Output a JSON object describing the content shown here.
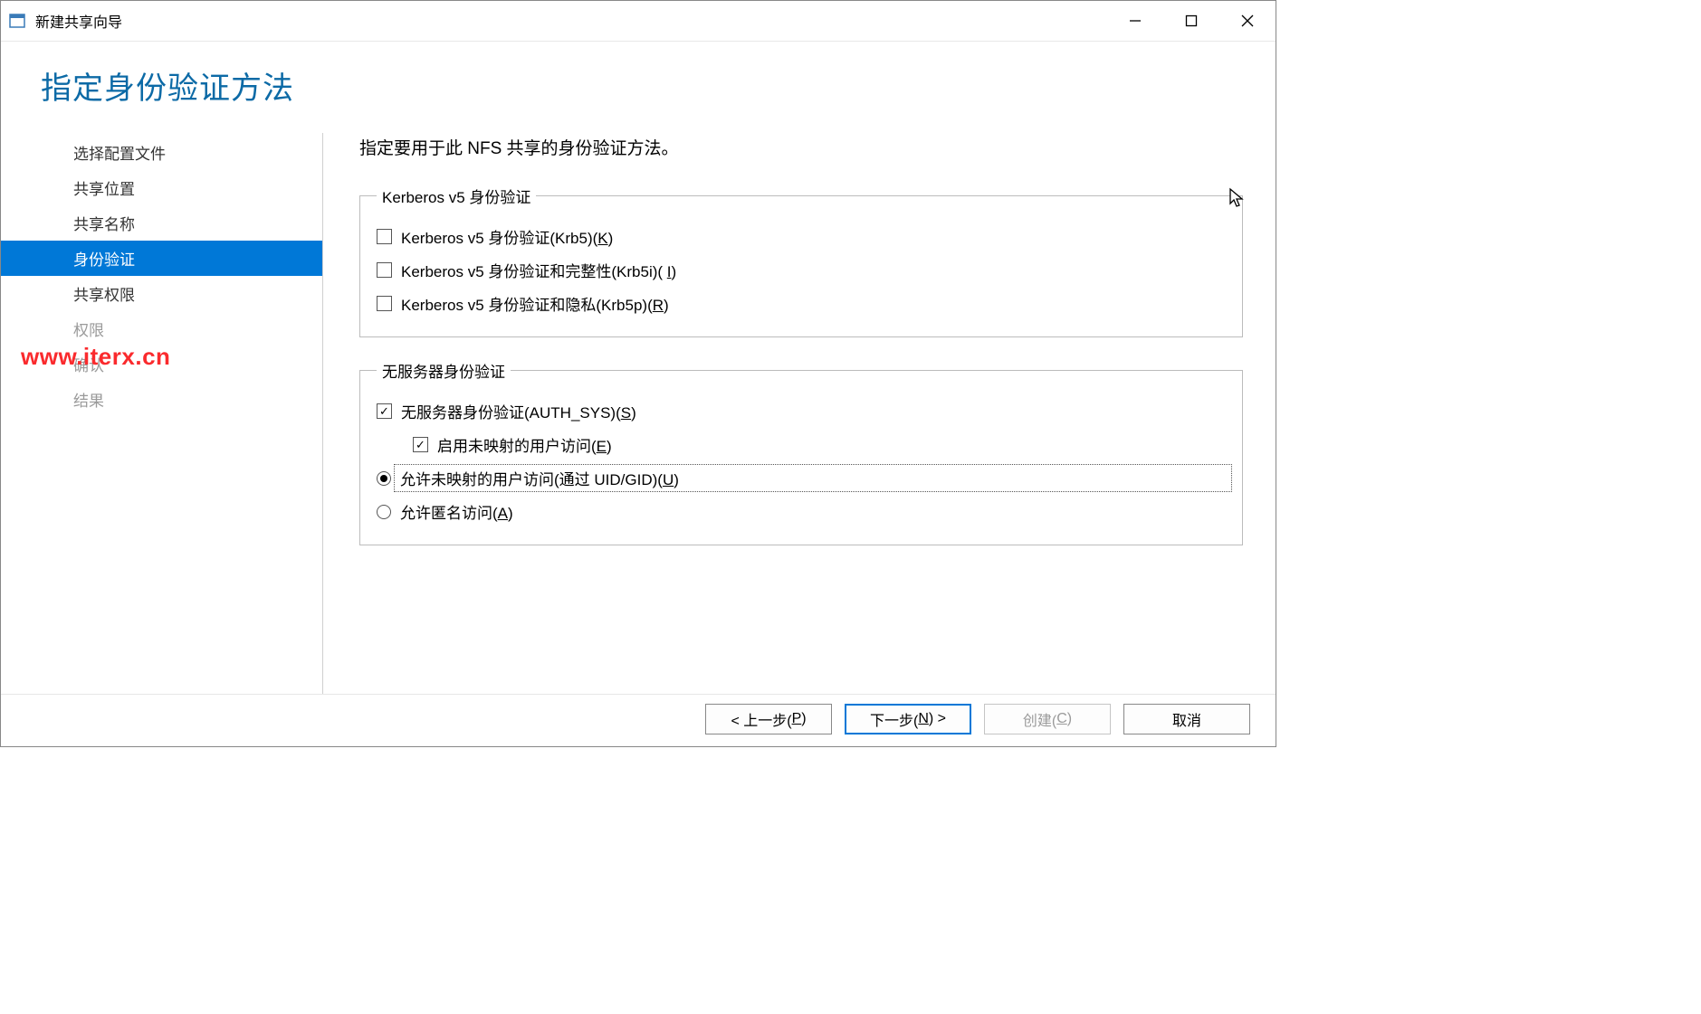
{
  "window": {
    "title": "新建共享向导"
  },
  "page": {
    "title": "指定身份验证方法",
    "intro": "指定要用于此 NFS 共享的身份验证方法。"
  },
  "sidebar": {
    "items": [
      {
        "label": "选择配置文件",
        "state": "normal"
      },
      {
        "label": "共享位置",
        "state": "normal"
      },
      {
        "label": "共享名称",
        "state": "normal"
      },
      {
        "label": "身份验证",
        "state": "active"
      },
      {
        "label": "共享权限",
        "state": "normal"
      },
      {
        "label": "权限",
        "state": "disabled"
      },
      {
        "label": "确认",
        "state": "disabled"
      },
      {
        "label": "结果",
        "state": "disabled"
      }
    ]
  },
  "kerberos": {
    "legend": "Kerberos v5 身份验证",
    "items": [
      {
        "text": "Kerberos v5 身份验证(Krb5)(",
        "hotkey": "K",
        "tail": ")",
        "checked": false
      },
      {
        "text": "Kerberos v5 身份验证和完整性(Krb5i)( ",
        "hotkey": "I",
        "tail": ")",
        "checked": false
      },
      {
        "text": "Kerberos v5 身份验证和隐私(Krb5p)(",
        "hotkey": "R",
        "tail": ")",
        "checked": false
      }
    ]
  },
  "noserver": {
    "legend": "无服务器身份验证",
    "authsys": {
      "text": "无服务器身份验证(AUTH_SYS)(",
      "hotkey": "S",
      "tail": ")",
      "checked": true
    },
    "unmapped": {
      "text": "启用未映射的用户访问(",
      "hotkey": "E",
      "tail": ")",
      "checked": true
    },
    "radios": [
      {
        "text": "允许未映射的用户访问(通过 UID/GID)(",
        "hotkey": "U",
        "tail": ")",
        "selected": true
      },
      {
        "text": "允许匿名访问(",
        "hotkey": "A",
        "tail": ")",
        "selected": false
      }
    ]
  },
  "buttons": {
    "prev_pre": "< 上一步(",
    "prev_hot": "P",
    "prev_post": ")",
    "next_pre": "下一步(",
    "next_hot": "N",
    "next_post": ") >",
    "create_pre": "创建(",
    "create_hot": "C",
    "create_post": ")",
    "cancel": "取消"
  },
  "watermark": "www.iterx.cn"
}
